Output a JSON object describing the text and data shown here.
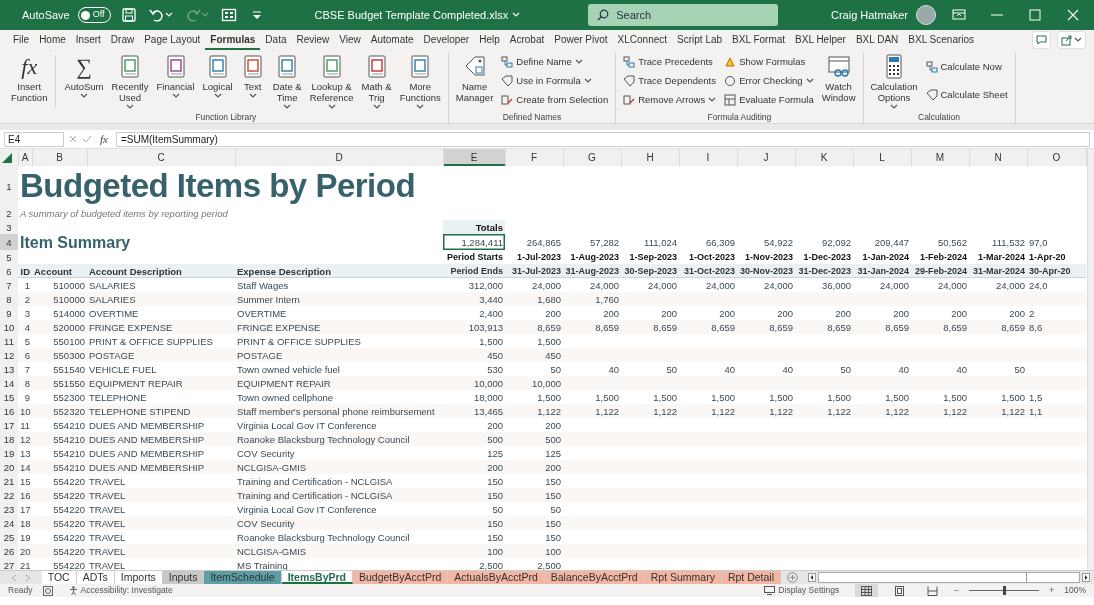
{
  "title_bar": {
    "autosave_label": "AutoSave",
    "autosave_on": false,
    "autosave_state": "Off",
    "file_name": "CBSE Budget Template Completed.xlsx",
    "search_placeholder": "Search",
    "user_name": "Craig Hatmaker"
  },
  "quick_access": [
    {
      "kind": "save",
      "disabled": false
    },
    {
      "kind": "undo",
      "disabled": false
    },
    {
      "kind": "redo",
      "disabled": true
    },
    {
      "kind": "form",
      "disabled": false
    },
    {
      "kind": "customize",
      "disabled": false
    }
  ],
  "ribbon_tabs": [
    {
      "label": "File",
      "selected": false
    },
    {
      "label": "Home",
      "selected": false
    },
    {
      "label": "Insert",
      "selected": false
    },
    {
      "label": "Draw",
      "selected": false
    },
    {
      "label": "Page Layout",
      "selected": false
    },
    {
      "label": "Formulas",
      "selected": true
    },
    {
      "label": "Data",
      "selected": false
    },
    {
      "label": "Review",
      "selected": false
    },
    {
      "label": "View",
      "selected": false
    },
    {
      "label": "Automate",
      "selected": false
    },
    {
      "label": "Developer",
      "selected": false
    },
    {
      "label": "Help",
      "selected": false
    },
    {
      "label": "Acrobat",
      "selected": false
    },
    {
      "label": "Power Pivot",
      "selected": false
    },
    {
      "label": "XLConnect",
      "selected": false
    },
    {
      "label": "Script Lab",
      "selected": false
    },
    {
      "label": "BXL Format",
      "selected": false
    },
    {
      "label": "BXL Helper",
      "selected": false
    },
    {
      "label": "BXL DAN",
      "selected": false
    },
    {
      "label": "BXL Scenarios",
      "selected": false
    }
  ],
  "ribbon": {
    "groups": [
      {
        "kind": "function-library",
        "label": "Function Library",
        "items": [
          {
            "kind": "large",
            "glyph": "fx",
            "lines": [
              "Insert",
              "Function"
            ],
            "dropdown": false,
            "divider_after": true
          },
          {
            "kind": "large",
            "glyph": "∑",
            "lines": [
              "AutoSum"
            ],
            "dropdown": true
          },
          {
            "kind": "large",
            "lines": [
              "Recently",
              "Used"
            ],
            "dropdown": true
          },
          {
            "kind": "large",
            "lines": [
              "Financial"
            ],
            "dropdown": true
          },
          {
            "kind": "large",
            "lines": [
              "Logical"
            ],
            "dropdown": true
          },
          {
            "kind": "large",
            "lines": [
              "Text"
            ],
            "dropdown": true
          },
          {
            "kind": "large",
            "lines": [
              "Date &",
              "Time"
            ],
            "dropdown": true
          },
          {
            "kind": "large",
            "lines": [
              "Lookup &",
              "Reference"
            ],
            "dropdown": true
          },
          {
            "kind": "large",
            "lines": [
              "Math &",
              "Trig"
            ],
            "dropdown": true
          },
          {
            "kind": "large",
            "lines": [
              "More",
              "Functions"
            ],
            "dropdown": true
          }
        ]
      },
      {
        "kind": "defined-names",
        "label": "Defined Names",
        "items": [
          {
            "kind": "large",
            "lines": [
              "Name",
              "Manager"
            ],
            "dropdown": false
          },
          {
            "kind": "small",
            "lines": [
              "Define Name"
            ],
            "dropdown": true
          },
          {
            "kind": "small",
            "lines": [
              "Use in Formula"
            ],
            "dropdown": true
          },
          {
            "kind": "small",
            "lines": [
              "Create from Selection"
            ],
            "dropdown": false
          }
        ]
      },
      {
        "kind": "formula-auditing",
        "label": "Formula Auditing",
        "items": [
          {
            "kind": "small",
            "lines": [
              "Trace Precedents"
            ],
            "dropdown": false
          },
          {
            "kind": "small",
            "lines": [
              "Trace Dependents"
            ],
            "dropdown": false
          },
          {
            "kind": "small",
            "lines": [
              "Remove Arrows"
            ],
            "dropdown": true
          },
          {
            "kind": "small",
            "lines": [
              "Show Formulas"
            ],
            "dropdown": false
          },
          {
            "kind": "small",
            "lines": [
              "Error Checking"
            ],
            "dropdown": true
          },
          {
            "kind": "small",
            "lines": [
              "Evaluate Formula"
            ],
            "dropdown": false
          },
          {
            "kind": "large",
            "lines": [
              "Watch",
              "Window"
            ],
            "dropdown": false
          }
        ]
      },
      {
        "kind": "calculation",
        "label": "Calculation",
        "items": [
          {
            "kind": "large",
            "lines": [
              "Calculation",
              "Options"
            ],
            "dropdown": true
          },
          {
            "kind": "small",
            "lines": [
              "Calculate Now"
            ],
            "dropdown": false
          },
          {
            "kind": "small",
            "lines": [
              "Calculate Sheet"
            ],
            "dropdown": false
          }
        ]
      }
    ]
  },
  "formula_bar": {
    "name_box": "E4",
    "fx": "fx",
    "formula": "=SUM(ItemSummary)"
  },
  "sheet": {
    "column_headers": [
      {
        "label": "A",
        "selected": false
      },
      {
        "label": "B",
        "selected": false
      },
      {
        "label": "C",
        "selected": false
      },
      {
        "label": "D",
        "selected": false
      },
      {
        "label": "E",
        "selected": true
      },
      {
        "label": "F",
        "selected": false
      },
      {
        "label": "G",
        "selected": false
      },
      {
        "label": "H",
        "selected": false
      },
      {
        "label": "I",
        "selected": false
      },
      {
        "label": "J",
        "selected": false
      },
      {
        "label": "K",
        "selected": false
      },
      {
        "label": "L",
        "selected": false
      },
      {
        "label": "M",
        "selected": false
      },
      {
        "label": "N",
        "selected": false
      },
      {
        "label": "O",
        "selected": false
      }
    ],
    "top_row_numbers": [
      {
        "label": "1",
        "selected": false
      },
      {
        "label": "2",
        "selected": false
      },
      {
        "label": "3",
        "selected": false
      },
      {
        "label": "4",
        "selected": true
      },
      {
        "label": "5",
        "selected": false
      },
      {
        "label": "6",
        "selected": false
      }
    ],
    "title": "Budgeted Items by Period",
    "subtitle": "A summary of budgeted items by reporting period",
    "totals_label": "Totals",
    "section_title": "Item Summary",
    "grand_total": "1,284,411",
    "grand_total_selected": true,
    "period_totals": [
      "264,865",
      "57,282",
      "111,024",
      "66,309",
      "54,922",
      "92,092",
      "209,447",
      "50,562",
      "111,532",
      "97,0"
    ],
    "period_starts_label": "Period Starts",
    "period_starts": [
      "1-Jul-2023",
      "1-Aug-2023",
      "1-Sep-2023",
      "1-Oct-2023",
      "1-Nov-2023",
      "1-Dec-2023",
      "1-Jan-2024",
      "1-Feb-2024",
      "1-Mar-2024",
      "1-Apr-20"
    ],
    "header": {
      "id": "ID",
      "account": "Account",
      "account_description": "Account Description",
      "expense_description": "Expense Description",
      "period_ends_label": "Period Ends"
    },
    "period_ends": [
      "31-Jul-2023",
      "31-Aug-2023",
      "30-Sep-2023",
      "31-Oct-2023",
      "30-Nov-2023",
      "31-Dec-2023",
      "31-Jan-2024",
      "29-Feb-2024",
      "31-Mar-2024",
      "30-Apr-20"
    ],
    "rows": [
      {
        "row": "7",
        "id": "1",
        "account": "510000",
        "account_description": "SALARIES",
        "expense_description": "Staff Wages",
        "total": "312,000",
        "periods": [
          "24,000",
          "24,000",
          "24,000",
          "24,000",
          "24,000",
          "36,000",
          "24,000",
          "24,000",
          "24,000",
          "24,0"
        ]
      },
      {
        "row": "8",
        "id": "2",
        "account": "510000",
        "account_description": "SALARIES",
        "expense_description": "Summer Intern",
        "total": "3,440",
        "periods": [
          "1,680",
          "1,760"
        ]
      },
      {
        "row": "9",
        "id": "3",
        "account": "514000",
        "account_description": "OVERTIME",
        "expense_description": "OVERTIME",
        "total": "2,400",
        "periods": [
          "200",
          "200",
          "200",
          "200",
          "200",
          "200",
          "200",
          "200",
          "200",
          "2"
        ]
      },
      {
        "row": "10",
        "id": "4",
        "account": "520000",
        "account_description": "FRINGE EXPENSE",
        "expense_description": "FRINGE EXPENSE",
        "total": "103,913",
        "periods": [
          "8,659",
          "8,659",
          "8,659",
          "8,659",
          "8,659",
          "8,659",
          "8,659",
          "8,659",
          "8,659",
          "8,6"
        ]
      },
      {
        "row": "11",
        "id": "5",
        "account": "550100",
        "account_description": "PRINT & OFFICE SUPPLIES",
        "expense_description": "PRINT & OFFICE SUPPLIES",
        "total": "1,500",
        "periods": [
          "1,500"
        ]
      },
      {
        "row": "12",
        "id": "6",
        "account": "550300",
        "account_description": "POSTAGE",
        "expense_description": "POSTAGE",
        "total": "450",
        "periods": [
          "450"
        ]
      },
      {
        "row": "13",
        "id": "7",
        "account": "551540",
        "account_description": "VEHICLE FUEL",
        "expense_description": "Town owned vehicle fuel",
        "total": "530",
        "periods": [
          "50",
          "40",
          "50",
          "40",
          "40",
          "50",
          "40",
          "40",
          "50"
        ]
      },
      {
        "row": "14",
        "id": "8",
        "account": "551550",
        "account_description": "EQUIPMENT REPAIR",
        "expense_description": "EQUIPMENT REPAIR",
        "total": "10,000",
        "periods": [
          "10,000"
        ]
      },
      {
        "row": "15",
        "id": "9",
        "account": "552300",
        "account_description": "TELEPHONE",
        "expense_description": "Town owned cellphone",
        "total": "18,000",
        "periods": [
          "1,500",
          "1,500",
          "1,500",
          "1,500",
          "1,500",
          "1,500",
          "1,500",
          "1,500",
          "1,500",
          "1,5"
        ]
      },
      {
        "row": "16",
        "id": "10",
        "account": "552320",
        "account_description": "TELEPHONE STIPEND",
        "expense_description": "Staff member's personal phone reimbursement",
        "total": "13,465",
        "periods": [
          "1,122",
          "1,122",
          "1,122",
          "1,122",
          "1,122",
          "1,122",
          "1,122",
          "1,122",
          "1,122",
          "1,1"
        ]
      },
      {
        "row": "17",
        "id": "11",
        "account": "554210",
        "account_description": "DUES AND MEMBERSHIP",
        "expense_description": "Virginia Local Gov IT Conference",
        "total": "200",
        "periods": [
          "200"
        ]
      },
      {
        "row": "18",
        "id": "12",
        "account": "554210",
        "account_description": "DUES AND MEMBERSHIP",
        "expense_description": "Roanoke Blacksburg Technology Council",
        "total": "500",
        "periods": [
          "500"
        ]
      },
      {
        "row": "19",
        "id": "13",
        "account": "554210",
        "account_description": "DUES AND MEMBERSHIP",
        "expense_description": "COV Security",
        "total": "125",
        "periods": [
          "125"
        ]
      },
      {
        "row": "20",
        "id": "14",
        "account": "554210",
        "account_description": "DUES AND MEMBERSHIP",
        "expense_description": "NCLGISA-GMIS",
        "total": "200",
        "periods": [
          "200"
        ]
      },
      {
        "row": "21",
        "id": "15",
        "account": "554220",
        "account_description": "TRAVEL",
        "expense_description": "Training and Certification - NCLGISA",
        "total": "150",
        "periods": [
          "150"
        ]
      },
      {
        "row": "22",
        "id": "16",
        "account": "554220",
        "account_description": "TRAVEL",
        "expense_description": "Training and Certification - NCLGISA",
        "total": "150",
        "periods": [
          "150"
        ]
      },
      {
        "row": "23",
        "id": "17",
        "account": "554220",
        "account_description": "TRAVEL",
        "expense_description": "Virginia Local Gov IT Conference",
        "total": "50",
        "periods": [
          "50"
        ]
      },
      {
        "row": "24",
        "id": "18",
        "account": "554220",
        "account_description": "TRAVEL",
        "expense_description": "COV Security",
        "total": "150",
        "periods": [
          "150"
        ]
      },
      {
        "row": "25",
        "id": "19",
        "account": "554220",
        "account_description": "TRAVEL",
        "expense_description": "Roanoke Blacksburg Technology Council",
        "total": "150",
        "periods": [
          "150"
        ]
      },
      {
        "row": "26",
        "id": "20",
        "account": "554220",
        "account_description": "TRAVEL",
        "expense_description": "NCLGISA-GMIS",
        "total": "100",
        "periods": [
          "100"
        ]
      },
      {
        "row": "27",
        "id": "21",
        "account": "554220",
        "account_description": "TRAVEL",
        "expense_description": "MS Training",
        "total": "2,500",
        "periods": [
          "2,500"
        ]
      }
    ]
  },
  "sheet_tabs": [
    {
      "label": "TOC",
      "color": "#ffffff",
      "selected": false
    },
    {
      "label": "ADTs",
      "color": "#ffffff",
      "selected": false
    },
    {
      "label": "Imports",
      "color": "#ffffff",
      "selected": false
    },
    {
      "label": "Inputs",
      "color": "#c8c8c8",
      "selected": false
    },
    {
      "label": "ItemSchedule",
      "color": "#5b9ea6",
      "selected": false
    },
    {
      "label": "ItemsByPrd",
      "color": "#ffffff",
      "selected": true
    },
    {
      "label": "BudgetByAcctPrd",
      "color": "#f3b6a2",
      "selected": false
    },
    {
      "label": "ActualsByAcctPrd",
      "color": "#f3b6a2",
      "selected": false
    },
    {
      "label": "BalanceByAcctPrd",
      "color": "#f3b6a2",
      "selected": false
    },
    {
      "label": "Rpt Summary",
      "color": "#f3b6a2",
      "selected": false
    },
    {
      "label": "Rpt Detail",
      "color": "#f3b6a2",
      "selected": false
    }
  ],
  "status_bar": {
    "state": "Ready",
    "accessibility": "Accessibility: Investigate",
    "display_settings": "Display Settings",
    "views": [
      {
        "kind": "normal",
        "selected": true
      },
      {
        "kind": "page-layout",
        "selected": false
      },
      {
        "kind": "page-break",
        "selected": false
      }
    ],
    "zoom_out": "−",
    "zoom_in": "+",
    "zoom": {
      "level": 0.5,
      "reading": "100%"
    }
  }
}
